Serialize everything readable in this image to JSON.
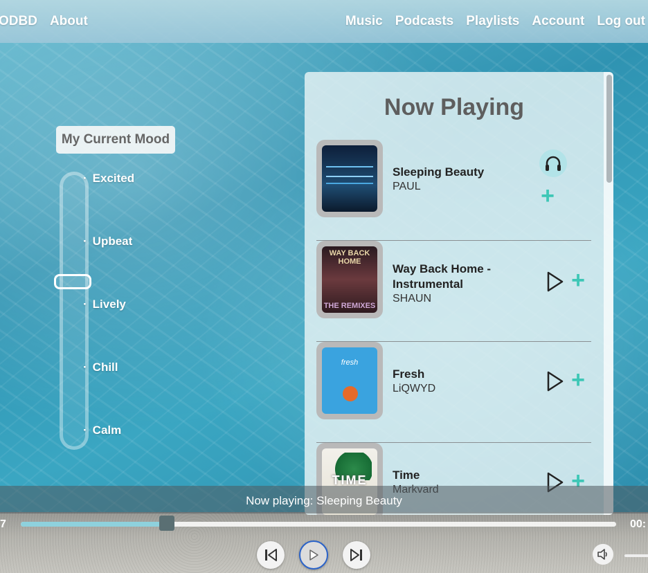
{
  "nav": {
    "brand": "ODBD",
    "about": "About",
    "music": "Music",
    "podcasts": "Podcasts",
    "playlists": "Playlists",
    "account": "Account",
    "logout": "Log out"
  },
  "mood": {
    "title": "My Current Mood",
    "levels": [
      "Excited",
      "Upbeat",
      "Lively",
      "Chill",
      "Calm"
    ],
    "selected_level": 0.65
  },
  "now_playing_panel": {
    "title": "Now Playing",
    "tracks": [
      {
        "title": "Sleeping Beauty",
        "artist": "PAUL",
        "state": "playing",
        "icon": "headphones-icon"
      },
      {
        "title": "Way Back Home - Instrumental",
        "artist": "SHAUN",
        "cover_text_top": "WAY BACK HOME",
        "cover_text_bottom": "THE REMIXES",
        "icon": "play-icon"
      },
      {
        "title": "Fresh",
        "artist": "LiQWYD",
        "cover_text": "fresh",
        "icon": "play-icon"
      },
      {
        "title": "Time",
        "artist": "Markvard",
        "cover_text": "TIME",
        "icon": "play-icon"
      }
    ]
  },
  "player": {
    "now_playing_text": "Now playing: Sleeping Beauty",
    "elapsed": "7",
    "total": "00:",
    "progress": 0.245,
    "colors": {
      "accent": "#3ec7b6",
      "progress": "#8ed1dd",
      "play_ring": "#2b63c9"
    }
  }
}
